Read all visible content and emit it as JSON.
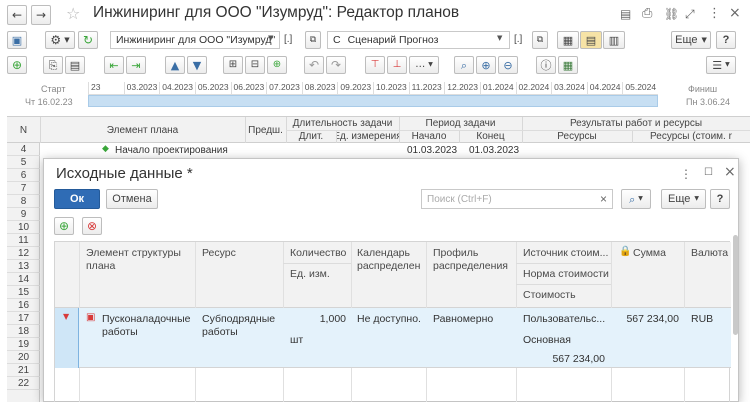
{
  "window": {
    "title": "Инжиниринг для ООО \"Изумруд\": Редактор планов"
  },
  "toolbar": {
    "plan_value": "Инжиниринг для ООО \"Изумруд\"",
    "plan_clear": "[.]",
    "scenario_prefix": "С",
    "scenario_value": "Сценарий Прогноз",
    "scenario_clear": "[.]",
    "more_label": "Еще",
    "help_label": "?"
  },
  "timeline": {
    "start_label": "Старт",
    "start_date": "Чт 16.02.23",
    "finish_label": "Финиш",
    "finish_date": "Пн 3.06.24",
    "months": [
      "23",
      "03.2023",
      "04.2023",
      "05.2023",
      "06.2023",
      "07.2023",
      "08.2023",
      "09.2023",
      "10.2023",
      "11.2023",
      "12.2023",
      "01.2024",
      "02.2024",
      "03.2024",
      "04.2024",
      "05.2024"
    ]
  },
  "grid": {
    "headers": {
      "n": "N",
      "element": "Элемент плана",
      "pred": "Предш.",
      "duration": "Длительность задачи",
      "duration_value": "Длит.",
      "duration_unit": "Ед. измерения",
      "period": "Период задачи",
      "start": "Начало",
      "end": "Конец",
      "results": "Результаты работ и ресурсы",
      "resources": "Ресурсы",
      "resources_cost": "Ресурсы (стоим. r"
    },
    "first_row": {
      "number": "4",
      "element": "Начало проектирования",
      "start": "01.03.2023",
      "end": "01.03.2023"
    },
    "row_numbers": [
      "5",
      "6",
      "7",
      "8",
      "9",
      "10",
      "11",
      "12",
      "13",
      "14",
      "15",
      "16",
      "17",
      "18",
      "19",
      "20",
      "21",
      "22"
    ]
  },
  "dialog": {
    "title": "Исходные данные *",
    "ok_label": "Ок",
    "cancel_label": "Отмена",
    "search_placeholder": "Поиск (Ctrl+F)",
    "search_clear": "×",
    "more_label": "Еще",
    "help_label": "?",
    "columns": {
      "element": "Элемент структуры плана",
      "resource": "Ресурс",
      "quantity": "Количество",
      "unit": "Ед. изм.",
      "calendar": "Календарь распределен",
      "profile": "Профиль распределения",
      "cost_source": "Источник стоим...",
      "cost_norm": "Норма стоимости",
      "cost": "Стоимость",
      "sum": "Сумма",
      "currency": "Валюта"
    },
    "row": {
      "element": "Пусконаладочные работы",
      "resource": "Субподрядные работы",
      "quantity": "1,000",
      "unit": "шт",
      "calendar": "Не доступно.",
      "profile": "Равномерно",
      "cost_source": "Пользовательс...",
      "cost_norm": "Основная",
      "cost": "567 234,00",
      "sum": "567 234,00",
      "currency": "RUB"
    }
  },
  "colors": {
    "accent": "#4d97d6",
    "ok_button": "#2f6cb5",
    "row_highlight": "#e4f2fb",
    "add_green": "#3aa63a",
    "delete_red": "#d83a3a"
  }
}
